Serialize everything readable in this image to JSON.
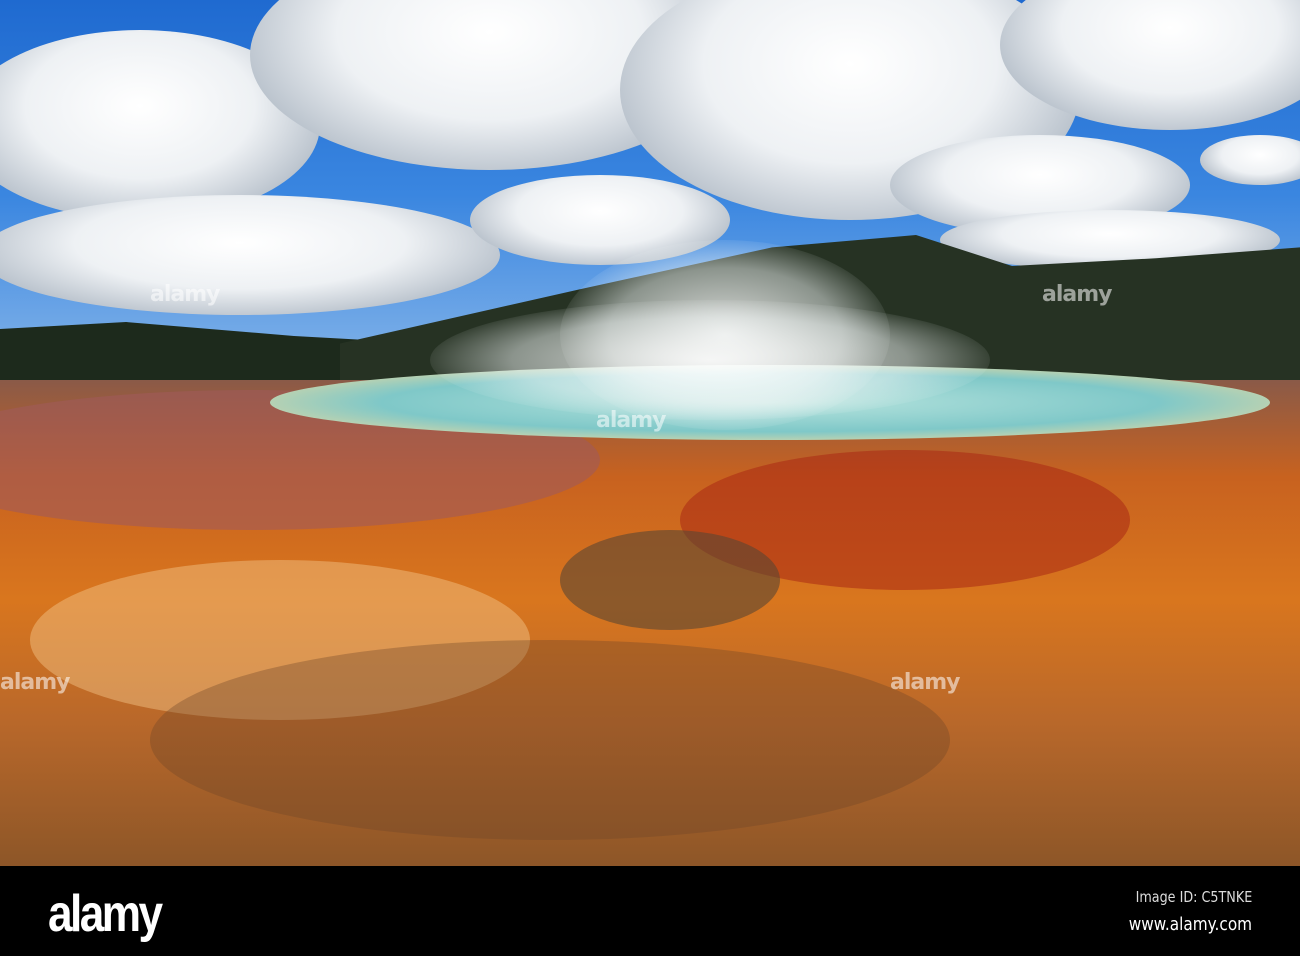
{
  "photo": {
    "watermark": "alamy"
  },
  "footer": {
    "logo": "alamy",
    "image_id": "Image ID: C5TNKE",
    "website": "www.alamy.com"
  }
}
